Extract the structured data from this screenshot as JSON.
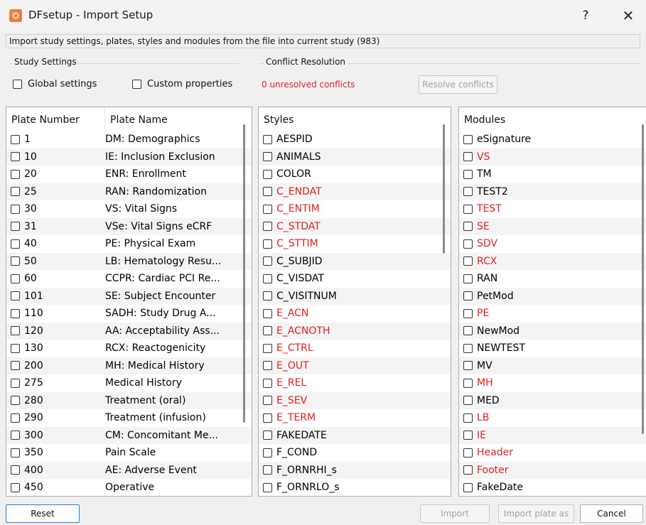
{
  "window": {
    "title": "DFsetup - Import Setup",
    "help_glyph": "?",
    "close_glyph": "✕"
  },
  "description": "Import study settings, plates, styles and modules from the file into current study (983)",
  "study_settings": {
    "title": "Study Settings",
    "global_label": "Global settings",
    "custom_label": "Custom properties"
  },
  "conflict": {
    "title": "Conflict Resolution",
    "status": "0 unresolved conflicts",
    "resolve_label": "Resolve conflicts"
  },
  "plates": {
    "col_number": "Plate Number",
    "col_name": "Plate Name",
    "rows": [
      {
        "number": "1",
        "name": "DM: Demographics"
      },
      {
        "number": "10",
        "name": "IE: Inclusion Exclusion"
      },
      {
        "number": "20",
        "name": "ENR: Enrollment"
      },
      {
        "number": "25",
        "name": "RAN: Randomization"
      },
      {
        "number": "30",
        "name": "VS: Vital Signs"
      },
      {
        "number": "31",
        "name": "VSe: Vital Signs eCRF"
      },
      {
        "number": "40",
        "name": "PE: Physical Exam"
      },
      {
        "number": "50",
        "name": "LB: Hematology Resu..."
      },
      {
        "number": "60",
        "name": "CCPR: Cardiac PCI Re..."
      },
      {
        "number": "101",
        "name": "SE: Subject Encounter"
      },
      {
        "number": "110",
        "name": "SADH: Study Drug A..."
      },
      {
        "number": "120",
        "name": "AA: Acceptability Ass..."
      },
      {
        "number": "130",
        "name": "RCX: Reactogenicity"
      },
      {
        "number": "200",
        "name": "MH: Medical History"
      },
      {
        "number": "275",
        "name": "Medical History"
      },
      {
        "number": "280",
        "name": "Treatment (oral)"
      },
      {
        "number": "290",
        "name": "Treatment (infusion)"
      },
      {
        "number": "300",
        "name": "CM: Concomitant Me..."
      },
      {
        "number": "350",
        "name": "Pain Scale"
      },
      {
        "number": "400",
        "name": "AE: Adverse Event"
      },
      {
        "number": "450",
        "name": "Operative"
      }
    ]
  },
  "styles": {
    "header": "Styles",
    "rows": [
      {
        "label": "AESPID",
        "conflict": false
      },
      {
        "label": "ANIMALS",
        "conflict": false
      },
      {
        "label": "COLOR",
        "conflict": false
      },
      {
        "label": "C_ENDAT",
        "conflict": true
      },
      {
        "label": "C_ENTIM",
        "conflict": true
      },
      {
        "label": "C_STDAT",
        "conflict": true
      },
      {
        "label": "C_STTIM",
        "conflict": true
      },
      {
        "label": "C_SUBJID",
        "conflict": false
      },
      {
        "label": "C_VISDAT",
        "conflict": false
      },
      {
        "label": "C_VISITNUM",
        "conflict": false
      },
      {
        "label": "E_ACN",
        "conflict": true
      },
      {
        "label": "E_ACNOTH",
        "conflict": true
      },
      {
        "label": "E_CTRL",
        "conflict": true
      },
      {
        "label": "E_OUT",
        "conflict": true
      },
      {
        "label": "E_REL",
        "conflict": true
      },
      {
        "label": "E_SEV",
        "conflict": true
      },
      {
        "label": "E_TERM",
        "conflict": true
      },
      {
        "label": "FAKEDATE",
        "conflict": false
      },
      {
        "label": "F_COND",
        "conflict": false
      },
      {
        "label": "F_ORNRHI_s",
        "conflict": false
      },
      {
        "label": "F_ORNRLO_s",
        "conflict": false
      }
    ]
  },
  "modules": {
    "header": "Modules",
    "rows": [
      {
        "label": "eSignature",
        "conflict": false
      },
      {
        "label": "VS",
        "conflict": true
      },
      {
        "label": "TM",
        "conflict": false
      },
      {
        "label": "TEST2",
        "conflict": false
      },
      {
        "label": "TEST",
        "conflict": true
      },
      {
        "label": "SE",
        "conflict": true
      },
      {
        "label": "SDV",
        "conflict": true
      },
      {
        "label": "RCX",
        "conflict": true
      },
      {
        "label": "RAN",
        "conflict": false
      },
      {
        "label": "PetMod",
        "conflict": false
      },
      {
        "label": "PE",
        "conflict": true
      },
      {
        "label": "NewMod",
        "conflict": false
      },
      {
        "label": "NEWTEST",
        "conflict": false
      },
      {
        "label": "MV",
        "conflict": false
      },
      {
        "label": "MH",
        "conflict": true
      },
      {
        "label": "MED",
        "conflict": false
      },
      {
        "label": "LB",
        "conflict": true
      },
      {
        "label": "IE",
        "conflict": true
      },
      {
        "label": "Header",
        "conflict": true
      },
      {
        "label": "Footer",
        "conflict": true
      },
      {
        "label": "FakeDate",
        "conflict": false
      }
    ]
  },
  "footer": {
    "reset_label": "Reset",
    "import_label": "Import",
    "import_plate_as_label": "Import plate as",
    "cancel_label": "Cancel"
  },
  "colors": {
    "conflict_red": "#e02020",
    "accent_blue": "#2a7fd4",
    "app_icon_orange": "#f07b3a"
  }
}
